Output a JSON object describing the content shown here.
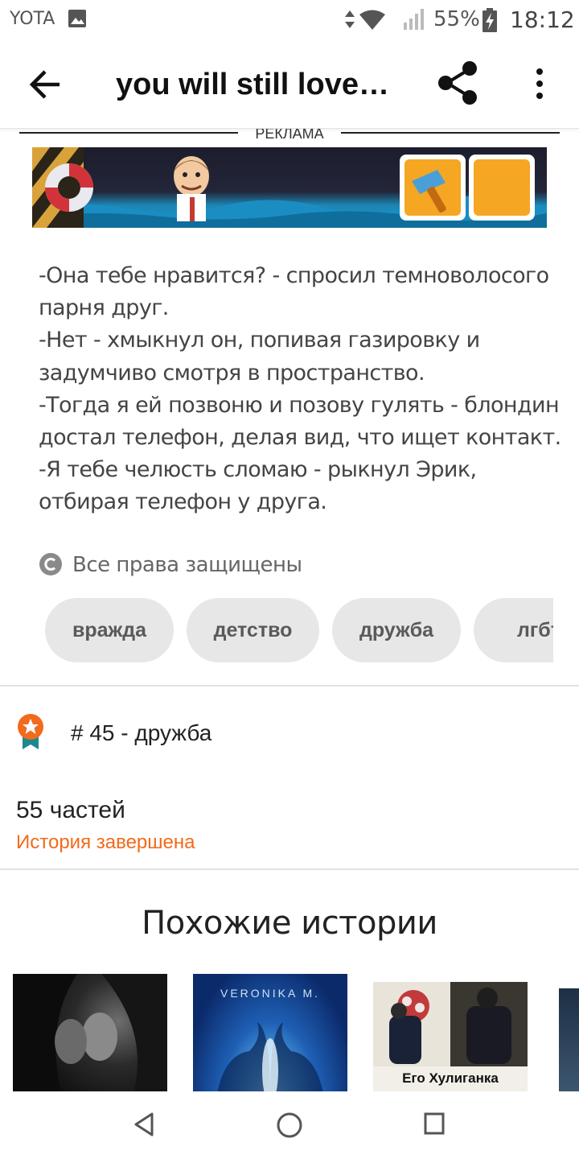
{
  "status_bar": {
    "carrier": "YOTA",
    "battery_percent": "55%",
    "time": "18:12",
    "icons": [
      "image-icon",
      "data-arrows-icon",
      "wifi-icon",
      "signal-icon",
      "battery-charging-icon"
    ]
  },
  "toolbar": {
    "title": "you will still love…",
    "back_icon": "arrow-left-icon",
    "share_icon": "share-icon",
    "more_icon": "more-vertical-icon"
  },
  "ad": {
    "label": "РЕКЛАМА"
  },
  "story": {
    "lines": [
      "-Она тебе нравится? - спросил темноволосого",
      "парня друг.",
      "-Нет - хмыкнул он, попивая газировку и",
      "задумчиво смотря в пространство.",
      "-Тогда я ей позвоню и позову гулять - блондин",
      "достал телефон, делая вид, что ищет контакт.",
      "-Я тебе челюсть сломаю - рыкнул Эрик,",
      "отбирая телефон у друга."
    ],
    "copyright": "Все права защищены"
  },
  "tags": [
    "вражда",
    "детство",
    "дружба",
    "лгбт"
  ],
  "ranking": {
    "text": "# 45 - дружба",
    "icon": "medal-icon"
  },
  "story_info": {
    "parts": "55 частей",
    "status": "История завершена"
  },
  "similar": {
    "title": "Похожие истории",
    "covers": [
      {
        "text": ""
      },
      {
        "text": "VERONIKA M."
      },
      {
        "text": "Его Хулиганка"
      },
      {
        "text": ""
      }
    ]
  },
  "colors": {
    "accent": "#f26a1b",
    "tag_bg": "#e7e7e7",
    "medal": "#f26a1b",
    "ribbon": "#1a8a8f"
  }
}
